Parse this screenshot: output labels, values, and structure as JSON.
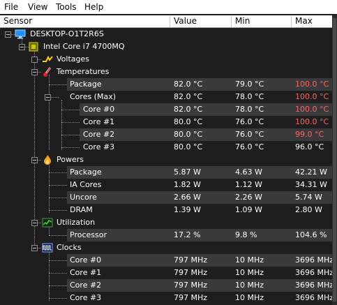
{
  "menu": [
    "File",
    "View",
    "Tools",
    "Help"
  ],
  "columns": [
    "Sensor",
    "Value",
    "Min",
    "Max"
  ],
  "tree": {
    "computer": {
      "label": "DESKTOP-O1T2R6S",
      "icon": "monitor-icon"
    },
    "cpu": {
      "label": "Intel Core i7 4700MQ",
      "icon": "cpu-chip-icon"
    },
    "groups": [
      {
        "id": "voltages",
        "label": "Voltages",
        "icon": "voltage-icon"
      },
      {
        "id": "temperatures",
        "label": "Temperatures",
        "icon": "thermometer-icon"
      },
      {
        "id": "powers",
        "label": "Powers",
        "icon": "flame-icon"
      },
      {
        "id": "utilization",
        "label": "Utilization",
        "icon": "utilization-graph-icon"
      },
      {
        "id": "clocks",
        "label": "Clocks",
        "icon": "clock-signal-icon"
      }
    ]
  },
  "rows": [
    {
      "label": "Package",
      "value": "82.0 °C",
      "min": "79.0 °C",
      "max": "100.0 °C",
      "max_color": "#ff6464"
    },
    {
      "label": "Cores (Max)",
      "value": "82.0 °C",
      "min": "78.0 °C",
      "max": "100.0 °C",
      "max_color": "#ff6464"
    },
    {
      "label": "Core #0",
      "value": "82.0 °C",
      "min": "78.0 °C",
      "max": "100.0 °C",
      "max_color": "#ff6464"
    },
    {
      "label": "Core #1",
      "value": "80.0 °C",
      "min": "76.0 °C",
      "max": "100.0 °C",
      "max_color": "#ff6464"
    },
    {
      "label": "Core #2",
      "value": "80.0 °C",
      "min": "76.0 °C",
      "max": "99.0 °C",
      "max_color": "#ff6464"
    },
    {
      "label": "Core #3",
      "value": "80.0 °C",
      "min": "76.0 °C",
      "max": "96.0 °C",
      "max_color": "#ffffff"
    },
    {
      "label": "Package",
      "value": "5.87 W",
      "min": "4.63 W",
      "max": "42.21 W",
      "max_color": "#ffffff"
    },
    {
      "label": "IA Cores",
      "value": "1.82 W",
      "min": "1.12 W",
      "max": "34.31 W",
      "max_color": "#ffffff"
    },
    {
      "label": "Uncore",
      "value": "2.66 W",
      "min": "2.26 W",
      "max": "5.74 W",
      "max_color": "#ffffff"
    },
    {
      "label": "DRAM",
      "value": "1.39 W",
      "min": "1.09 W",
      "max": "2.80 W",
      "max_color": "#ffffff"
    },
    {
      "label": "Processor",
      "value": "17.2 %",
      "min": "9.8 %",
      "max": "104.6 %",
      "max_color": "#ffffff"
    },
    {
      "label": "Core #0",
      "value": "797 MHz",
      "min": "10 MHz",
      "max": "3696 MHz",
      "max_color": "#ffffff"
    },
    {
      "label": "Core #1",
      "value": "797 MHz",
      "min": "10 MHz",
      "max": "3696 MHz",
      "max_color": "#ffffff"
    },
    {
      "label": "Core #2",
      "value": "797 MHz",
      "min": "10 MHz",
      "max": "3696 MHz",
      "max_color": "#ffffff"
    },
    {
      "label": "Core #3",
      "value": "797 MHz",
      "min": "10 MHz",
      "max": "3696 MHz",
      "max_color": "#ffffff"
    }
  ]
}
